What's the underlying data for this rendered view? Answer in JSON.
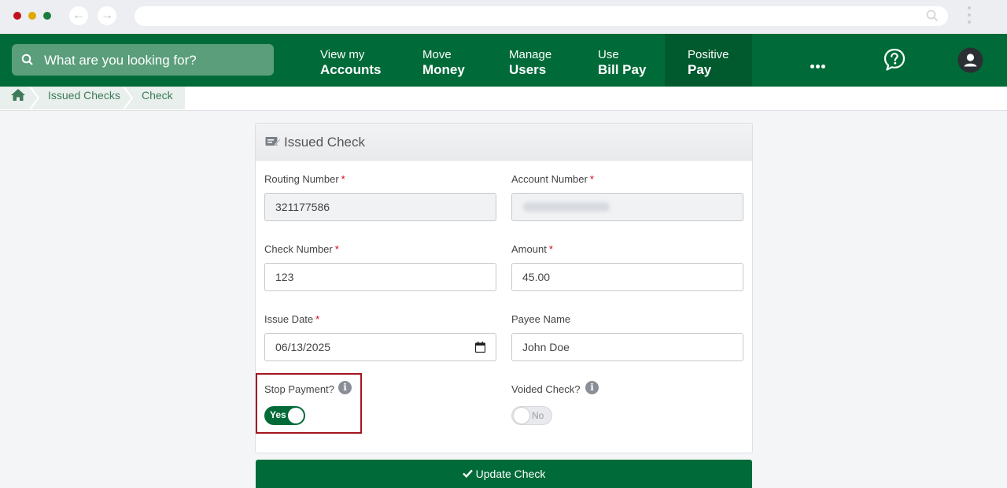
{
  "search": {
    "placeholder": "What are you looking for?"
  },
  "nav": {
    "items": [
      {
        "line1": "View my",
        "line2": "Accounts"
      },
      {
        "line1": "Move",
        "line2": "Money"
      },
      {
        "line1": "Manage",
        "line2": "Users"
      },
      {
        "line1": "Use",
        "line2": "Bill Pay"
      },
      {
        "line1": "Positive",
        "line2": "Pay"
      }
    ]
  },
  "breadcrumb": {
    "items": [
      "Issued Checks",
      "Check"
    ]
  },
  "card": {
    "title": "Issued Check",
    "routing": {
      "label": "Routing Number",
      "value": "321177586"
    },
    "account": {
      "label": "Account Number",
      "value": ""
    },
    "check_number": {
      "label": "Check Number",
      "value": "123"
    },
    "amount": {
      "label": "Amount",
      "value": "45.00"
    },
    "issue_date": {
      "label": "Issue Date",
      "value": "06/13/2025"
    },
    "payee": {
      "label": "Payee Name",
      "value": "John Doe"
    },
    "stop_payment": {
      "label": "Stop Payment?",
      "state": "Yes"
    },
    "voided": {
      "label": "Voided Check?",
      "state": "No"
    },
    "required_mark": "*",
    "info_glyph": "i"
  },
  "actions": {
    "update_label": "Update Check"
  },
  "colors": {
    "brand_green": "#006b38",
    "active_nav": "#005a2e",
    "required": "#d0021b",
    "highlight": "#a31621"
  }
}
